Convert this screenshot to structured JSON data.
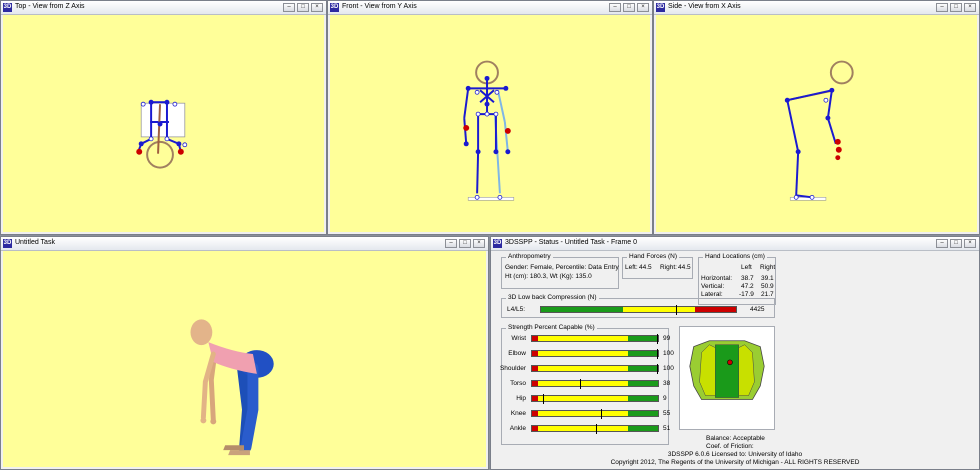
{
  "windows": {
    "top": {
      "title": "Top - View from Z Axis"
    },
    "front": {
      "title": "Front - View from Y Axis"
    },
    "side": {
      "title": "Side - View from X Axis"
    },
    "task": {
      "title": "Untitled Task"
    },
    "status": {
      "title": "3DSSPP - Status - Untitled Task - Frame 0"
    }
  },
  "app_icon": "3D",
  "window_buttons": [
    "–",
    "□",
    "×"
  ],
  "anthropometry": {
    "title": "Anthropometry",
    "line1": "Gender: Female, Percentile: Data Entry",
    "line2": "Ht (cm): 180.3, Wt (Kg): 135.0"
  },
  "hand_forces": {
    "title": "Hand Forces (N)",
    "left_label": "Left:",
    "left_value": "44.5",
    "right_label": "Right:",
    "right_value": "44.5"
  },
  "hand_locations": {
    "title": "Hand Locations (cm)",
    "col_left": "Left",
    "col_right": "Right",
    "rows": [
      {
        "label": "Horizontal:",
        "left": "38.7",
        "right": "39.1"
      },
      {
        "label": "Vertical:",
        "left": "47.2",
        "right": "50.9"
      },
      {
        "label": "Lateral:",
        "left": "-17.9",
        "right": "21.7"
      }
    ]
  },
  "compression": {
    "title": "3D Low back Compression (N)",
    "label": "L4/L5:",
    "value": "4425",
    "value_num": 4425,
    "scale_max": 6400
  },
  "strength": {
    "title": "Strength Percent Capable (%)",
    "rows": [
      {
        "label": "Wrist",
        "value": "99",
        "pct": 99
      },
      {
        "label": "Elbow",
        "value": "100",
        "pct": 100
      },
      {
        "label": "Shoulder",
        "value": "100",
        "pct": 100
      },
      {
        "label": "Torso",
        "value": "38",
        "pct": 38
      },
      {
        "label": "Hip",
        "value": "9",
        "pct": 9
      },
      {
        "label": "Knee",
        "value": "55",
        "pct": 55
      },
      {
        "label": "Ankle",
        "value": "51",
        "pct": 51
      }
    ]
  },
  "balance": {
    "label": "Balance: Acceptable",
    "friction": "Coef. of Friction:"
  },
  "footer": {
    "line1": "3DSSPP 6.0.6 Licensed to: University of Idaho",
    "line2": "Copyright 2012, The Regents of the University of Michigan - ALL RIGHTS RESERVED"
  },
  "colors": {
    "viewport_bg": "#ffff99",
    "skeleton": "#1a1ad0",
    "skeleton_light": "#7fb6e6",
    "hand_red": "#cc0000",
    "bar_green": "#1a9a1a",
    "bar_yellow": "#ffff00",
    "bar_red": "#cc0000"
  }
}
